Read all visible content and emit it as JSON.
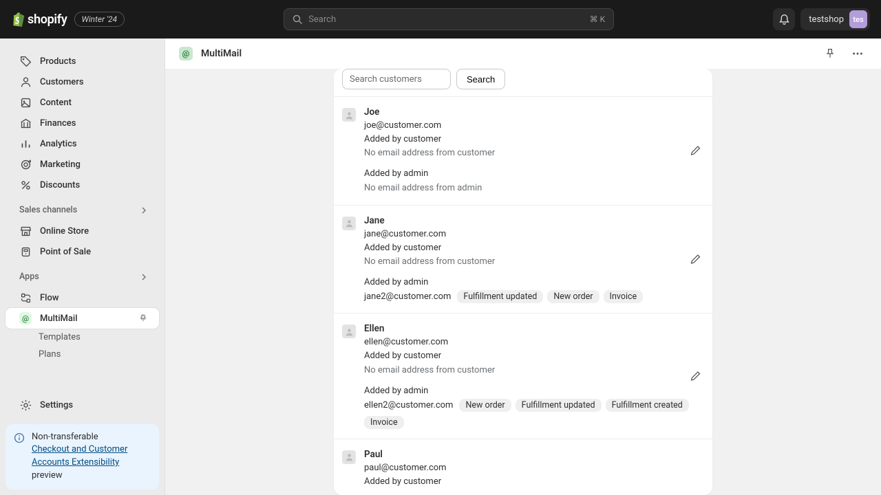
{
  "brand": {
    "name": "shopify",
    "pill": "Winter '24"
  },
  "search": {
    "placeholder": "Search",
    "shortcut": "⌘ K"
  },
  "user": {
    "name": "testshop",
    "initials": "tes"
  },
  "nav": {
    "items": [
      {
        "label": "Products",
        "icon": "tag"
      },
      {
        "label": "Customers",
        "icon": "person"
      },
      {
        "label": "Content",
        "icon": "image"
      },
      {
        "label": "Finances",
        "icon": "bank"
      },
      {
        "label": "Analytics",
        "icon": "bars"
      },
      {
        "label": "Marketing",
        "icon": "target"
      },
      {
        "label": "Discounts",
        "icon": "percent"
      }
    ],
    "channels_label": "Sales channels",
    "channels": [
      {
        "label": "Online Store",
        "icon": "store"
      },
      {
        "label": "Point of Sale",
        "icon": "pos"
      }
    ],
    "apps_label": "Apps",
    "apps": [
      {
        "label": "Flow",
        "icon": "flow"
      }
    ],
    "active_app": {
      "label": "MultiMail",
      "icon": "@"
    },
    "active_subs": [
      {
        "label": "Templates"
      },
      {
        "label": "Plans"
      }
    ],
    "settings": "Settings"
  },
  "banner": {
    "line1": "Non-transferable",
    "link": "Checkout and Customer Accounts Extensibility",
    "line3": "preview"
  },
  "page": {
    "title": "MultiMail"
  },
  "panel": {
    "search_placeholder": "Search customers",
    "search_btn": "Search"
  },
  "customers": [
    {
      "name": "Joe",
      "email": "joe@customer.com",
      "by_customer": "Added by customer",
      "cust_note": "No email address from customer",
      "by_admin": "Added by admin",
      "admin_email": "",
      "admin_note": "No email address from admin",
      "tags": []
    },
    {
      "name": "Jane",
      "email": "jane@customer.com",
      "by_customer": "Added by customer",
      "cust_note": "No email address from customer",
      "by_admin": "Added by admin",
      "admin_email": "jane2@customer.com",
      "admin_note": "",
      "tags": [
        "Fulfillment updated",
        "New order",
        "Invoice"
      ]
    },
    {
      "name": "Ellen",
      "email": "ellen@customer.com",
      "by_customer": "Added by customer",
      "cust_note": "No email address from customer",
      "by_admin": "Added by admin",
      "admin_email": "ellen2@customer.com",
      "admin_note": "",
      "tags": [
        "New order",
        "Fulfillment updated",
        "Fulfillment created",
        "Invoice"
      ]
    },
    {
      "name": "Paul",
      "email": "paul@customer.com",
      "by_customer": "Added by customer",
      "cust_note": "",
      "by_admin": "",
      "admin_email": "",
      "admin_note": "",
      "tags": []
    }
  ]
}
